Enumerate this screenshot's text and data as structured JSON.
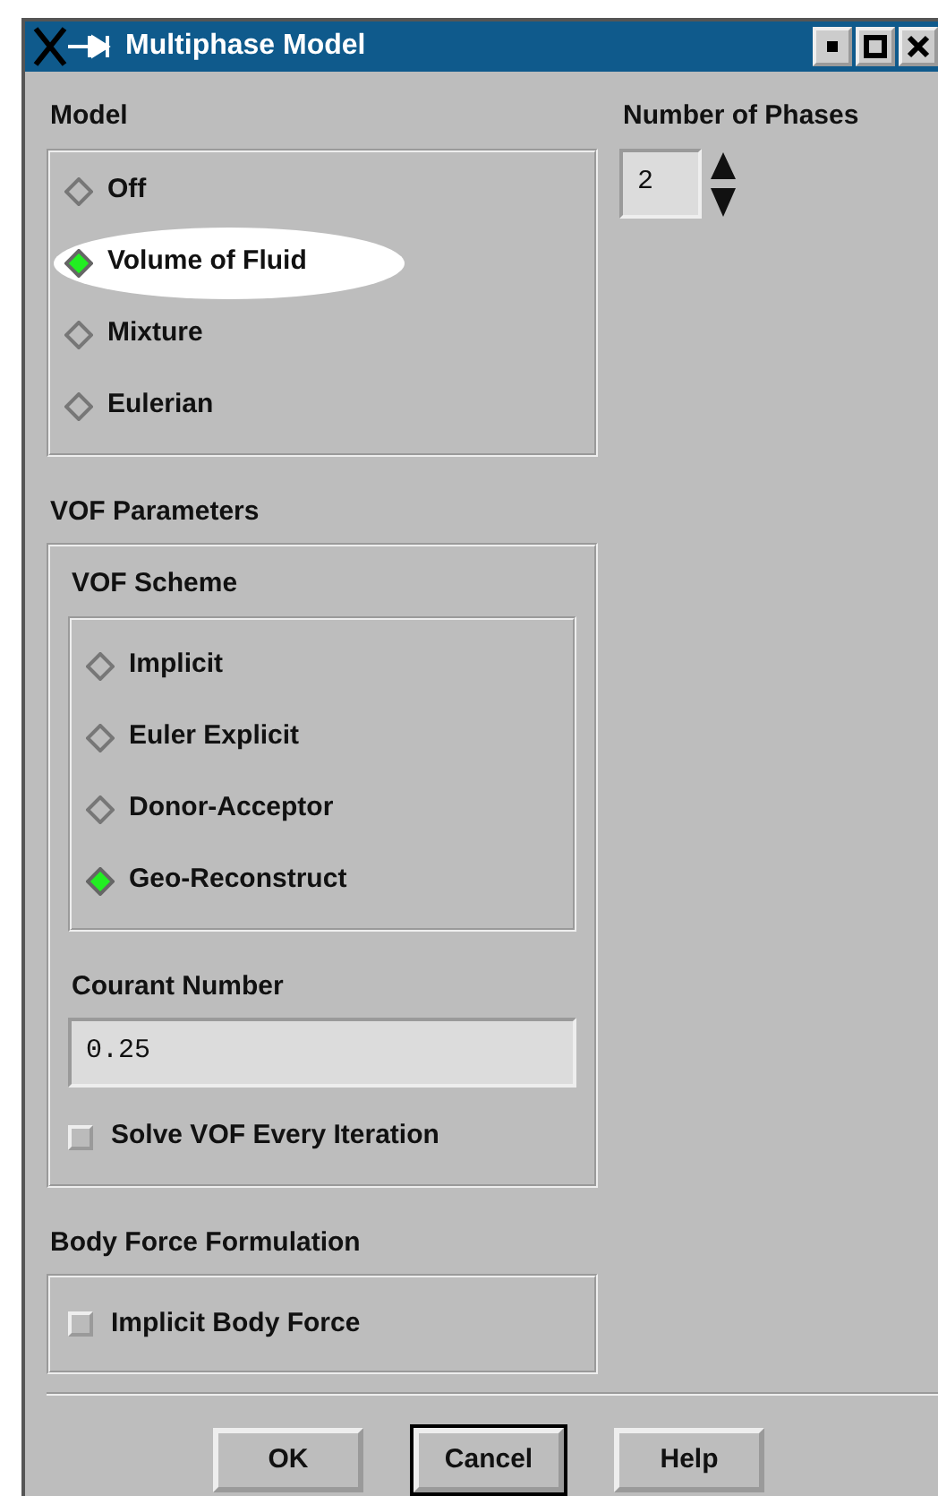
{
  "window": {
    "title": "Multiphase Model"
  },
  "model": {
    "label": "Model",
    "options": [
      {
        "label": "Off",
        "selected": false,
        "highlighted": false
      },
      {
        "label": "Volume of Fluid",
        "selected": true,
        "highlighted": true
      },
      {
        "label": "Mixture",
        "selected": false,
        "highlighted": false
      },
      {
        "label": "Eulerian",
        "selected": false,
        "highlighted": false
      }
    ]
  },
  "number_of_phases": {
    "label": "Number of Phases",
    "value": "2"
  },
  "vof_parameters": {
    "label": "VOF Parameters",
    "vof_scheme": {
      "label": "VOF Scheme",
      "options": [
        {
          "label": "Implicit",
          "selected": false
        },
        {
          "label": "Euler Explicit",
          "selected": false
        },
        {
          "label": "Donor-Acceptor",
          "selected": false
        },
        {
          "label": "Geo-Reconstruct",
          "selected": true
        }
      ]
    },
    "courant_number": {
      "label": "Courant Number",
      "value": "0.25"
    },
    "solve_every_iteration": {
      "label": "Solve VOF Every Iteration",
      "checked": false
    }
  },
  "body_force": {
    "label": "Body Force Formulation",
    "implicit": {
      "label": "Implicit Body Force",
      "checked": false
    }
  },
  "buttons": [
    {
      "label": "OK",
      "default": false
    },
    {
      "label": "Cancel",
      "default": true
    },
    {
      "label": "Help",
      "default": false
    }
  ]
}
